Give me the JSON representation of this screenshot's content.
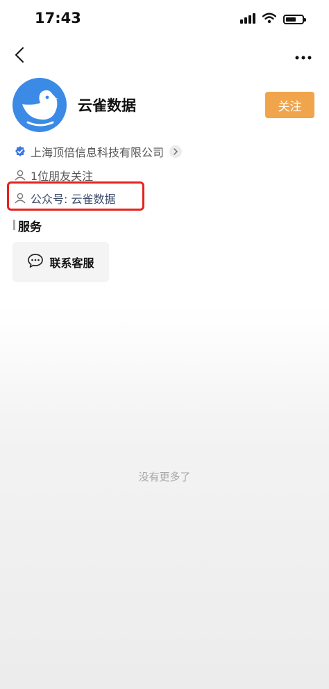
{
  "status_bar": {
    "time": "17:43",
    "battery_level": 0.65
  },
  "nav": {
    "back_icon": "chevron-left-icon",
    "more_icon": "more-horizontal-icon"
  },
  "profile": {
    "name": "云雀数据",
    "follow_label": "关注",
    "company": "上海顶倍信息科技有限公司",
    "friends_following": "1位朋友关注",
    "official_account": "公众号: 云雀数据"
  },
  "services": {
    "title": "服务",
    "items": [
      {
        "label": "联系客服",
        "icon": "chat-bubble-icon"
      }
    ]
  },
  "footer": {
    "end_text": "没有更多了"
  },
  "colors": {
    "follow_button": "#f0a54d",
    "avatar_bg": "#3b8ae6",
    "verified_badge": "#3b76e0",
    "highlight_box": "#e8211e",
    "account_text": "#3d4c6b"
  }
}
